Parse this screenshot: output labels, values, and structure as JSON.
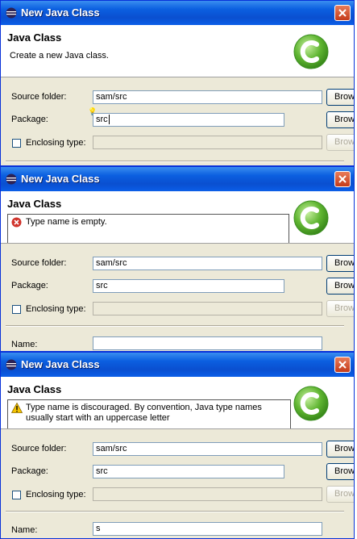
{
  "windows": [
    {
      "title": "New Java Class",
      "banner_title": "Java Class",
      "banner_message": "Create a new Java class.",
      "message_type": "info",
      "source_folder_label": "Source folder:",
      "source_folder_value": "sam/src",
      "package_label": "Package:",
      "package_value": "src",
      "enclosing_label": "Enclosing type:",
      "enclosing_value": "",
      "name_label": "",
      "name_value": "",
      "browse_label": "Browse..."
    },
    {
      "title": "New Java Class",
      "banner_title": "Java Class",
      "banner_message": "Type name is empty.",
      "message_type": "error",
      "source_folder_label": "Source folder:",
      "source_folder_value": "sam/src",
      "package_label": "Package:",
      "package_value": "src",
      "enclosing_label": "Enclosing type:",
      "enclosing_value": "",
      "name_label": "Name:",
      "name_value": "",
      "browse_label": "Browse..."
    },
    {
      "title": "New Java Class",
      "banner_title": "Java Class",
      "banner_message": "Type name is discouraged. By convention, Java type names usually start with an uppercase letter",
      "message_type": "warning",
      "source_folder_label": "Source folder:",
      "source_folder_value": "sam/src",
      "package_label": "Package:",
      "package_value": "src",
      "enclosing_label": "Enclosing type:",
      "enclosing_value": "",
      "name_label": "Name:",
      "name_value": "s",
      "browse_label": "Browse..."
    }
  ],
  "colors": {
    "titlebar": "#0a4fd0",
    "dialog_bg": "#ece9d8",
    "error": "#d0342c",
    "warning": "#f5c400",
    "logo_green": "#5fb531"
  },
  "icons": {
    "app": "eclipse-icon",
    "close": "close-icon",
    "logo": "java-class-logo-icon",
    "error": "error-icon",
    "warning": "warning-icon"
  }
}
